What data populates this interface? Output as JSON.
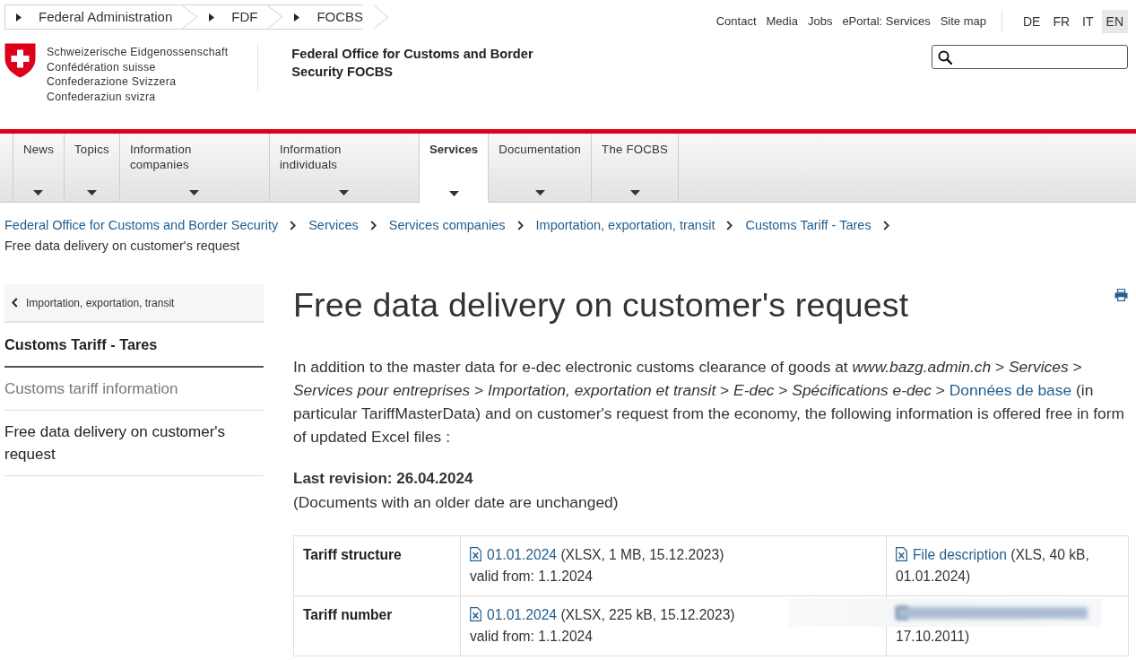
{
  "top_breadcrumb": [
    {
      "label": "Federal Administration"
    },
    {
      "label": "FDF"
    },
    {
      "label": "FOCBS"
    }
  ],
  "service_links": [
    "Contact",
    "Media",
    "Jobs",
    "ePortal: Services",
    "Site map"
  ],
  "languages": [
    {
      "label": "DE",
      "selected": false
    },
    {
      "label": "FR",
      "selected": false
    },
    {
      "label": "IT",
      "selected": false
    },
    {
      "label": "EN",
      "selected": true
    }
  ],
  "logo": {
    "lines": [
      "Schweizerische Eidgenossenschaft",
      "Confédération suisse",
      "Confederazione Svizzera",
      "Confederaziun svizra"
    ]
  },
  "site_title": "Federal Office for Customs and Border Security FOCBS",
  "main_nav": [
    {
      "label": "News",
      "selected": false
    },
    {
      "label": "Topics",
      "selected": false
    },
    {
      "label": "Information companies",
      "selected": false
    },
    {
      "label": "Information individuals",
      "selected": false
    },
    {
      "label": "Services",
      "selected": true
    },
    {
      "label": "Documentation",
      "selected": false
    },
    {
      "label": "The FOCBS",
      "selected": false
    }
  ],
  "breadcrumb": {
    "links": [
      "Federal Office for Customs and Border Security",
      "Services",
      "Services companies",
      "Importation, exportation, transit",
      "Customs Tariff - Tares"
    ],
    "current": "Free data delivery on customer's request"
  },
  "sidebar": {
    "back": "Importation, exportation, transit",
    "heading": "Customs Tariff - Tares",
    "items": [
      {
        "label": "Customs tariff information",
        "selected": false
      },
      {
        "label": "Free data delivery on customer's request",
        "selected": true
      }
    ]
  },
  "page": {
    "title": "Free data delivery on customer's request",
    "intro": {
      "before": "In addition to the master data for e-dec electronic customs clearance of goods at *www.bazg.admin.ch* > *Services* > *Services pour entreprises* > *Importation, exportation et transit* > *E-dec* > *Spécifications e-dec* > ",
      "link": "Données de base",
      "after": " (in particular TariffMasterData) and on customer's request from the economy, the following information is offered free in form of updated Excel files :"
    },
    "revision": "Last revision: 26.04.2024",
    "note": "(Documents with an older date are unchanged)"
  },
  "table": {
    "rows": [
      {
        "label": "Tariff structure",
        "file": {
          "link": "01.01.2024",
          "info": " (XLSX, 1 MB, 15.12.2023)",
          "valid": "valid from: 1.1.2024"
        },
        "description": {
          "kind": "link",
          "link": "File description",
          "info": " (XLS, 40 kB, 01.01.2024)"
        }
      },
      {
        "label": "Tariff number",
        "file": {
          "link": "01.01.2024",
          "info": " (XLSX, 225 kB, 15.12.2023)",
          "valid": "valid from: 1.1.2024"
        },
        "description": {
          "kind": "obscured",
          "info": "17.10.2011)"
        }
      }
    ]
  }
}
